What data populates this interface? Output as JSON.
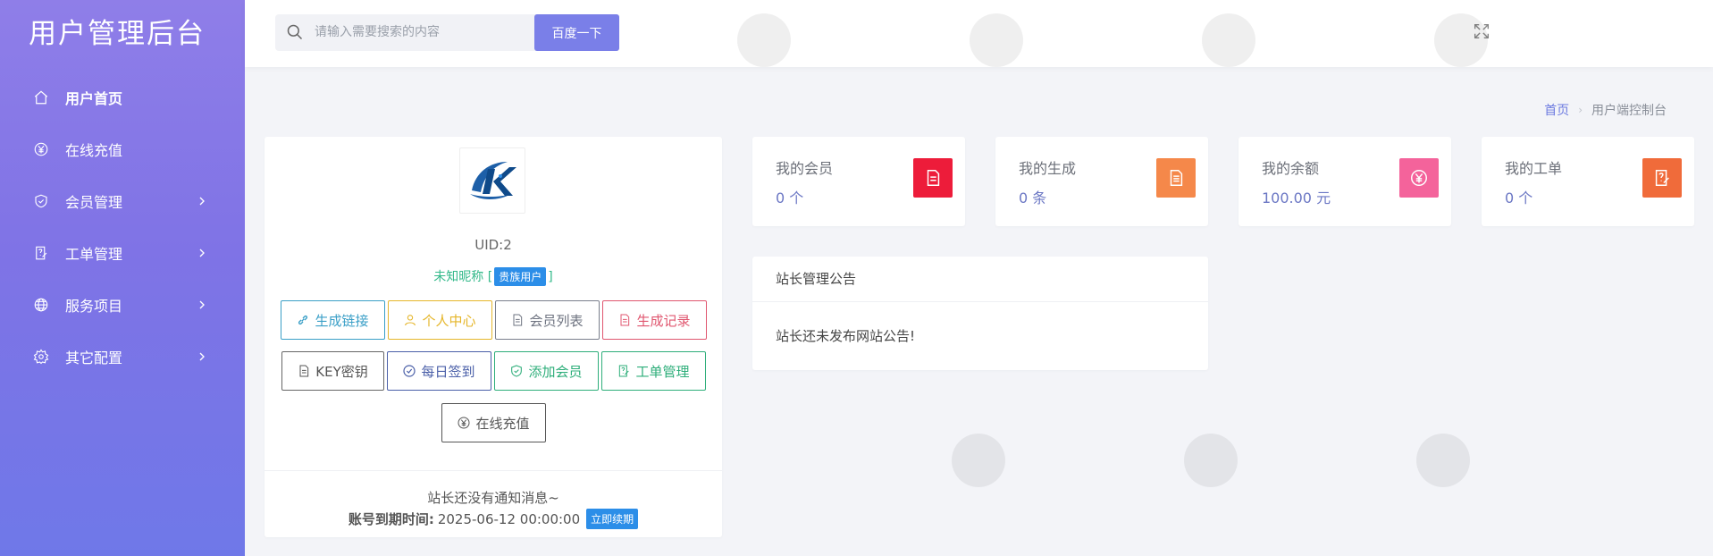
{
  "sidebar": {
    "brand": "用户管理后台",
    "items": [
      {
        "label": "用户首页",
        "icon": "home-icon"
      },
      {
        "label": "在线充值",
        "icon": "yen-icon"
      },
      {
        "label": "会员管理",
        "icon": "shield-icon"
      },
      {
        "label": "工单管理",
        "icon": "ticket-icon"
      },
      {
        "label": "服务项目",
        "icon": "globe-icon"
      },
      {
        "label": "其它配置",
        "icon": "gear-icon"
      }
    ]
  },
  "topbar": {
    "search_placeholder": "请输入需要搜索的内容",
    "search_button": "百度一下"
  },
  "breadcrumb": {
    "home": "首页",
    "current": "用户端控制台"
  },
  "profile": {
    "uid": "UID:2",
    "nickname": "未知昵称",
    "role_badge": "贵族用户",
    "buttons_row1": [
      "生成链接",
      "个人中心",
      "会员列表",
      "生成记录"
    ],
    "buttons_row2": [
      "KEY密钥",
      "每日签到",
      "添加会员",
      "工单管理"
    ],
    "buttons_row3": [
      "在线充值"
    ],
    "notice": "站长还没有通知消息~",
    "expire_label": "账号到期时间:",
    "expire_value": "2025-06-12 00:00:00",
    "renew_button": "立即续期"
  },
  "stats": [
    {
      "title": "我的会员",
      "value": "0 个",
      "color": "#ed1c3a",
      "icon": "file-icon"
    },
    {
      "title": "我的生成",
      "value": "0 条",
      "color": "#f5884a",
      "icon": "document-icon"
    },
    {
      "title": "我的余额",
      "value": "100.00 元",
      "color": "#f4639b",
      "icon": "yen-icon"
    },
    {
      "title": "我的工单",
      "value": "0 个",
      "color": "#f06b3a",
      "icon": "edit-icon"
    }
  ],
  "announcement": {
    "title": "站长管理公告",
    "body": "站长还未发布网站公告!"
  }
}
